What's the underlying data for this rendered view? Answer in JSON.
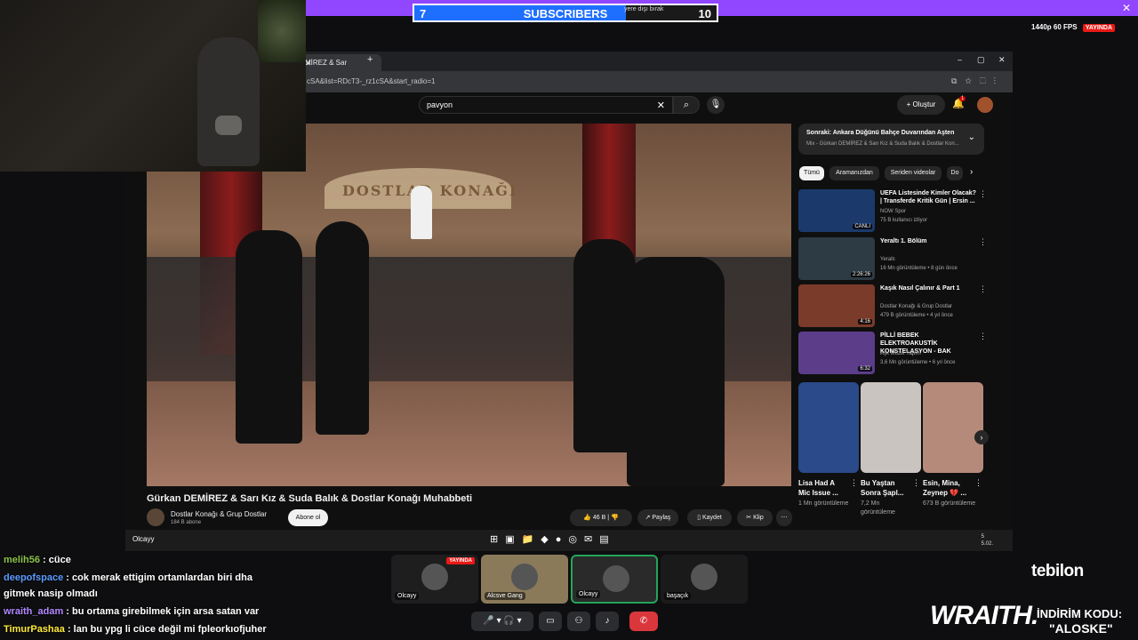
{
  "overlay": {
    "subscriber_goal": {
      "left": "7",
      "title": "SUBSCRIBERS",
      "right": "10",
      "small_text": "yere dışı bırak",
      "progress": 0.7
    },
    "close_glyph": "✕",
    "quality": "1440p 60 FPS",
    "live_badge": "YAYINDA"
  },
  "browser": {
    "tab_title": "MİREZ & Sar",
    "url": "cSA&list=RDcT3-_rz1cSA&start_radio=1",
    "window_controls": [
      "–",
      "▢",
      "✕"
    ]
  },
  "youtube": {
    "search_value": "pavyon",
    "create_label": "Oluştur",
    "notification_count": "1",
    "video_title": "Gürkan DEMİREZ & Sarı Kız & Suda Balık & Dostlar Konağı Muhabbeti",
    "channel_name": "Dostlar Konağı & Grup Dostlar",
    "channel_subs": "184 B abone",
    "subscribe_label": "Abone ol",
    "actions": {
      "likes": "46 B",
      "share": "Paylaş",
      "save": "Kaydet",
      "clip": "Klip"
    },
    "video_sign_text": "DOSTLAR KONAĞI",
    "next_up": {
      "title": "Sonraki: Ankara Düğünü Bahçe Duvarından Aşten",
      "subtitle": "Mix - Gürkan DEMİREZ & Sarı Kız & Suda Balık & Dostlar Kon..."
    },
    "chips": [
      "Tümü",
      "Aramanızdan",
      "Seriden videolar",
      "Do"
    ],
    "recommendations": [
      {
        "title": "UEFA Listesinde Kimler Olacak? | Transferde Kritik Gün | Ersin ...",
        "channel": "NOW Spor",
        "meta": "75 B kullanıcı izliyor",
        "duration": "CANLI",
        "color": "#1b3a6b"
      },
      {
        "title": "Yeraltı 1. Bölüm",
        "channel": "Yeraltı",
        "meta": "16 Mn görüntüleme • 8 gün önce",
        "duration": "2:26:26",
        "color": "#2d3b44"
      },
      {
        "title": "Kaşık Nasıl Çalınır & Part 1",
        "channel": "Dostlar Konağı & Grup Dostlar",
        "meta": "479 B görüntüleme • 4 yıl önce",
        "duration": "4:16",
        "color": "#7a3b2a"
      },
      {
        "title": "PİLLİ BEBEK ELEKTROAKUSTİK KONSTELASYON - BAK",
        "channel": "Aşk Müzik Yapım",
        "meta": "3,6 Mn görüntüleme • 6 yıl önce",
        "duration": "6:32",
        "color": "#5b3d8a"
      }
    ],
    "shorts": [
      {
        "title": "Lisa Had A Mic Issue ...",
        "meta": "1 Mn görüntüleme",
        "color": "#2a4a8a"
      },
      {
        "title": "Bu Yaştan Sonra Şapl...",
        "meta": "7,2 Mn görüntüleme",
        "color": "#c9c4c0"
      },
      {
        "title": "Esin, Mina, Zeynep 💔 ...",
        "meta": "673 B görüntüleme",
        "color": "#b58a7a"
      }
    ]
  },
  "taskbar": {
    "user": "Olcayy",
    "time": "5",
    "date": "5.02."
  },
  "chat": [
    {
      "user": "melih56",
      "color": "#8bc34a",
      "text": " : cüce"
    },
    {
      "user": "deepofspace",
      "color": "#5b9bff",
      "text": " : cok merak ettigim ortamlardan biri dha gitmek nasip olmadı"
    },
    {
      "user": "wraith_adam",
      "color": "#b388ff",
      "text": " : bu ortama girebilmek için arsa satan var"
    },
    {
      "user": "TimurPashaa",
      "color": "#ffeb3b",
      "text": " : lan bu ypg li cüce değil mi fpleorkıofjuher"
    }
  ],
  "discord": {
    "tiles": [
      {
        "label": "Olcayy",
        "live": "YAYINDA",
        "color": "#1e1e1e"
      },
      {
        "label": "Alcsve Gang",
        "color": "#8a7a5a"
      },
      {
        "label": "Olcayy",
        "color": "#2a2a2a"
      },
      {
        "label": "başaçık",
        "color": "#1a1a1a"
      }
    ]
  },
  "sponsor": {
    "brand1": "tebilon",
    "brand2": "WRAITH.",
    "promo_label": "İNDİRİM KODU:",
    "promo_code": "\"ALOSKE\""
  }
}
